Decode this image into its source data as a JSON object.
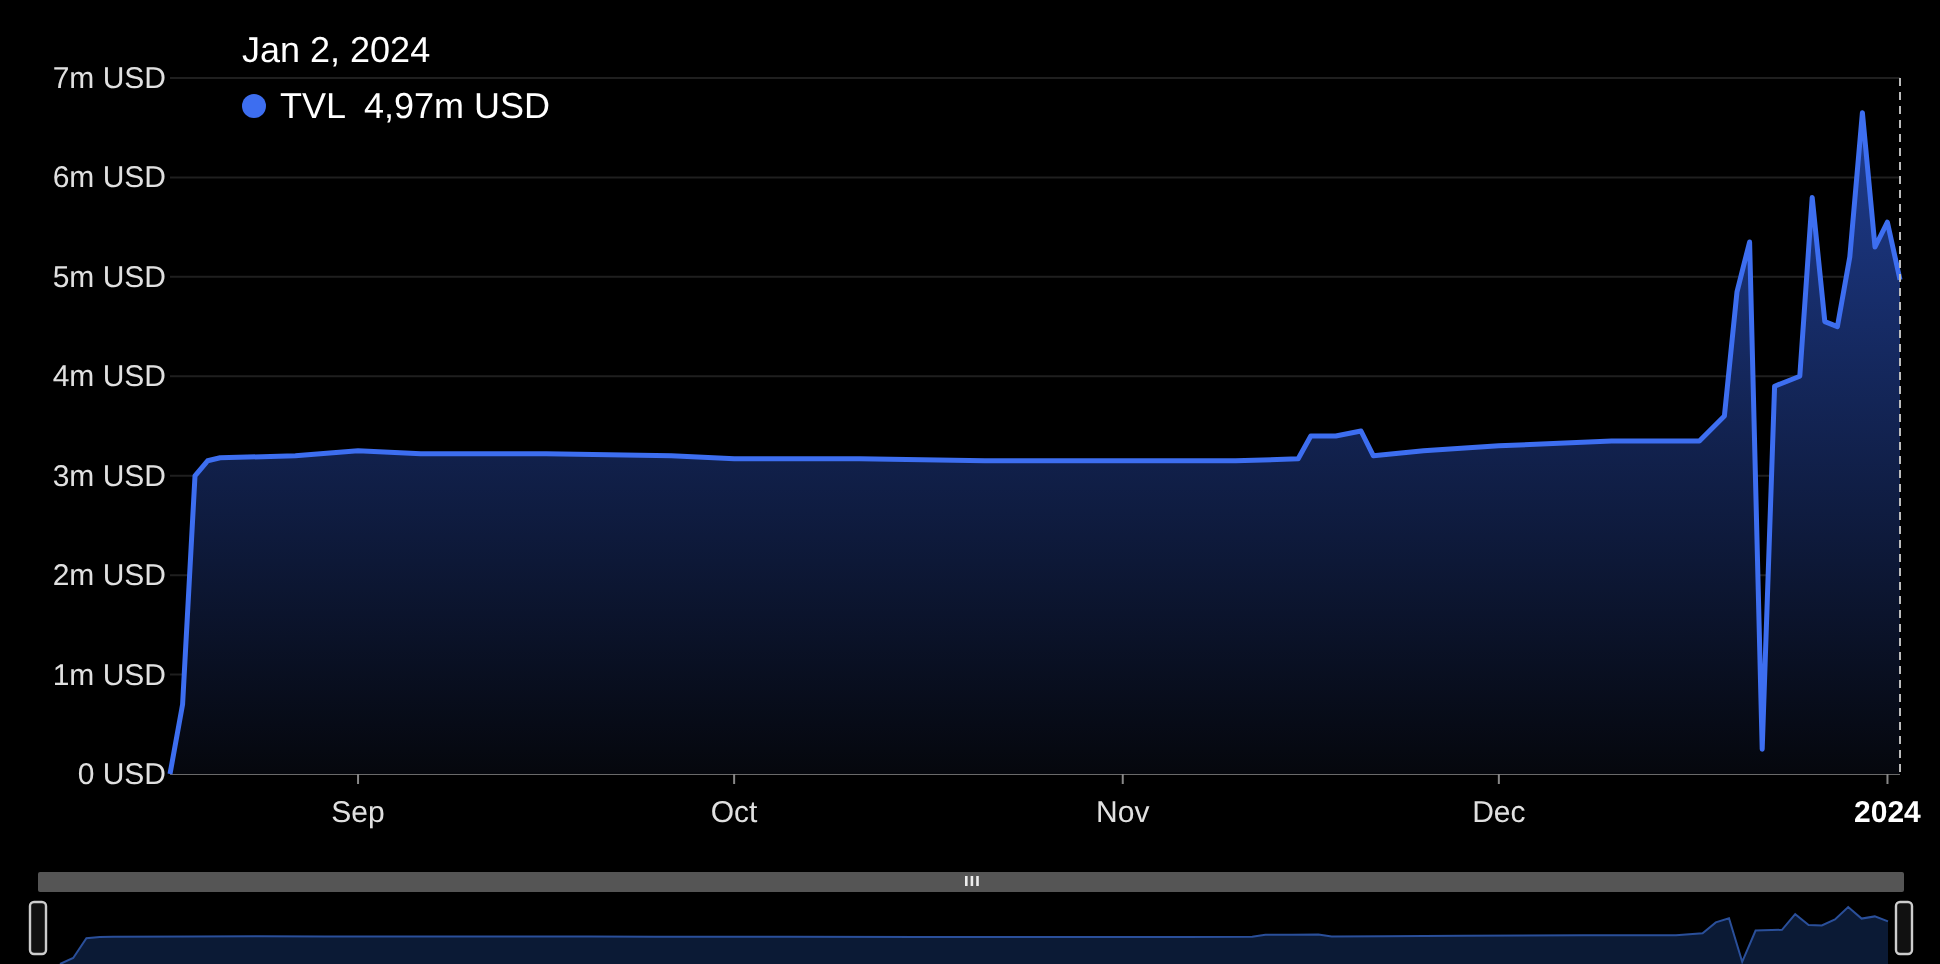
{
  "chart": {
    "tooltip": {
      "date": "Jan 2, 2024",
      "value": "4,97m USD"
    },
    "chart_data": {
      "type": "area",
      "x": [
        "2023-08-17",
        "2023-08-18",
        "2023-08-19",
        "2023-08-20",
        "2023-08-21",
        "2023-08-27",
        "2023-09-01",
        "2023-09-06",
        "2023-09-16",
        "2023-09-26",
        "2023-10-01",
        "2023-10-11",
        "2023-10-21",
        "2023-11-01",
        "2023-11-10",
        "2023-11-15",
        "2023-11-16",
        "2023-11-18",
        "2023-11-20",
        "2023-11-21",
        "2023-11-25",
        "2023-12-01",
        "2023-12-10",
        "2023-12-17",
        "2023-12-19",
        "2023-12-20",
        "2023-12-21",
        "2023-12-22",
        "2023-12-23",
        "2023-12-25",
        "2023-12-26",
        "2023-12-27",
        "2023-12-28",
        "2023-12-29",
        "2023-12-30",
        "2023-12-31",
        "2024-01-01",
        "2024-01-02"
      ],
      "series": [
        {
          "name": "TVL",
          "color": "#3d6ef0",
          "values": [
            0,
            0.7,
            3.0,
            3.15,
            3.18,
            3.2,
            3.25,
            3.22,
            3.22,
            3.2,
            3.17,
            3.17,
            3.15,
            3.15,
            3.15,
            3.17,
            3.4,
            3.4,
            3.45,
            3.2,
            3.25,
            3.3,
            3.35,
            3.35,
            3.6,
            4.85,
            5.35,
            0.25,
            3.9,
            4.0,
            5.8,
            4.55,
            4.5,
            5.2,
            6.65,
            5.3,
            5.55,
            4.97
          ]
        }
      ],
      "xlim": [
        "2023-08-17",
        "2024-01-02"
      ],
      "ylim": [
        0,
        7
      ],
      "grid": true,
      "xticks": [
        {
          "value": "2023-09-01",
          "label": "Sep"
        },
        {
          "value": "2023-10-01",
          "label": "Oct"
        },
        {
          "value": "2023-11-01",
          "label": "Nov"
        },
        {
          "value": "2023-12-01",
          "label": "Dec"
        },
        {
          "value": "2024-01-01",
          "label": "2024"
        }
      ],
      "yticks": [
        {
          "value": 0,
          "label": "0 USD"
        },
        {
          "value": 1,
          "label": "1m USD"
        },
        {
          "value": 2,
          "label": "2m USD"
        },
        {
          "value": 3,
          "label": "3m USD"
        },
        {
          "value": 4,
          "label": "4m USD"
        },
        {
          "value": 5,
          "label": "5m USD"
        },
        {
          "value": 6,
          "label": "6m USD"
        },
        {
          "value": 7,
          "label": "7m USD"
        }
      ]
    }
  }
}
